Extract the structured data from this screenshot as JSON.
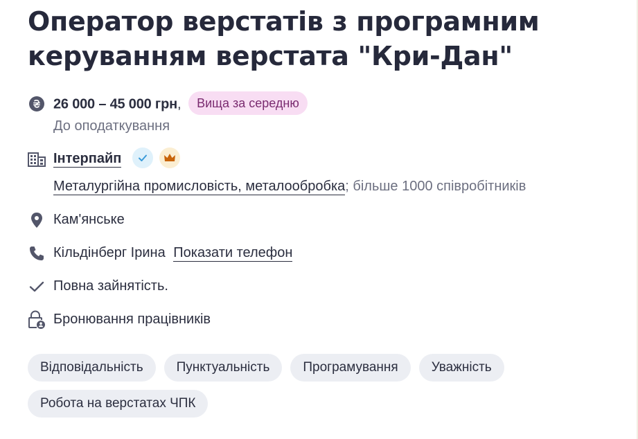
{
  "vacancy": {
    "title": "Оператор верстатів з програмним керуванням верстата \"Кри-Дан\""
  },
  "salary": {
    "value": "26 000 – 45 000 грн",
    "separator": ",",
    "badge": "Вища за середню",
    "note": "До оподаткування"
  },
  "company": {
    "name": "Інтерпайп",
    "industry": "Металургійна промисловість, металообробка",
    "size": "; більше 1000 співробітників"
  },
  "location": {
    "city": "Кам'янське"
  },
  "contact": {
    "name": "Кільдінберг Ірина",
    "show_phone": "Показати телефон"
  },
  "employment": {
    "type": "Повна зайнятість."
  },
  "reservation": {
    "text": "Бронювання працівників"
  },
  "skills": [
    "Відповідальність",
    "Пунктуальність",
    "Програмування",
    "Уважність",
    "Робота на верстатах ЧПК"
  ],
  "colors": {
    "text": "#2b2e3f",
    "muted": "#6c6f80",
    "badge_bg": "#f8ddf3",
    "badge_text": "#7a2b70",
    "tag_bg": "#eceef3",
    "verified": "#3a9bd9",
    "crown": "#c8640a"
  },
  "icons": {
    "salary": "hryvnia-icon",
    "company": "building-icon",
    "verified": "check-badge-icon",
    "top_employer": "crown-icon",
    "location": "map-pin-icon",
    "contact": "phone-icon",
    "employment": "check-icon",
    "reservation": "lock-person-icon"
  }
}
